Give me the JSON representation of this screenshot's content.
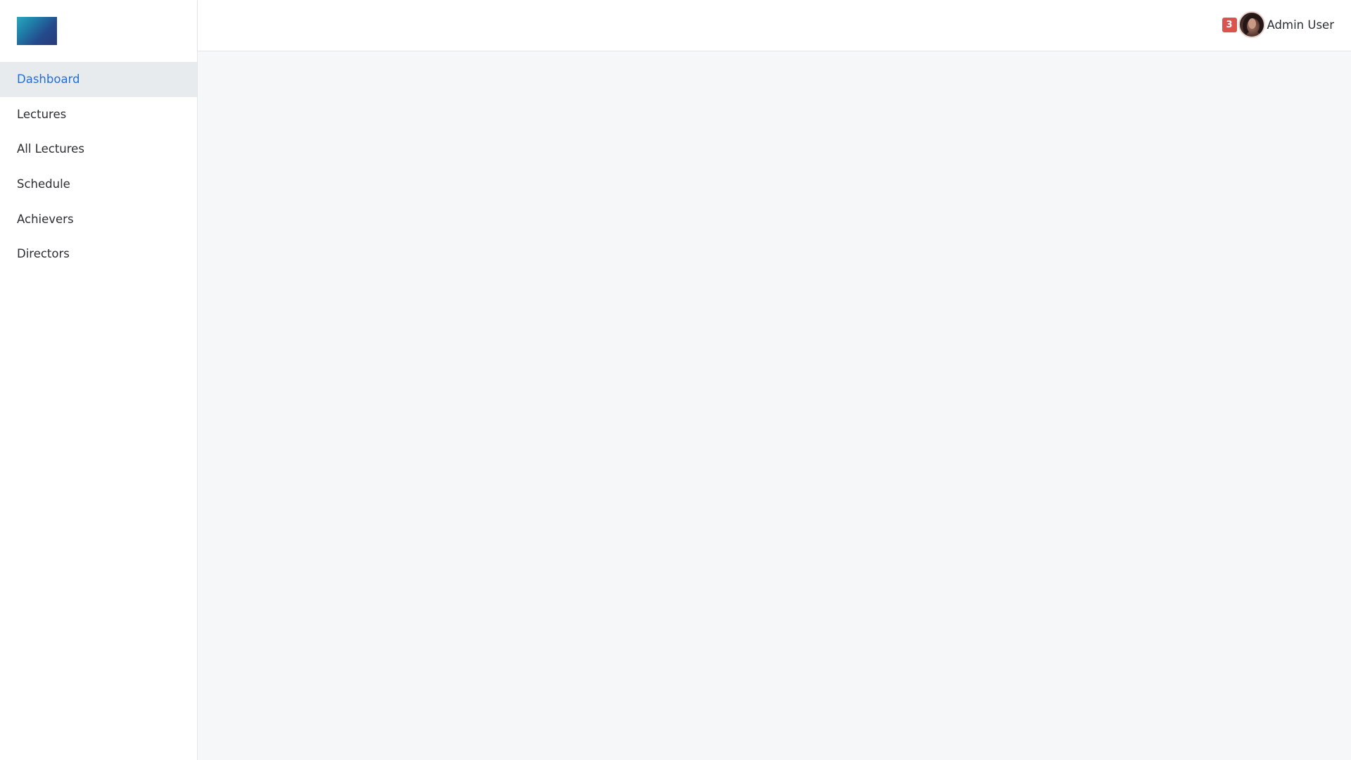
{
  "sidebar": {
    "logo": "brand-logo",
    "items": [
      {
        "label": "Dashboard",
        "active": true
      },
      {
        "label": "Lectures",
        "active": false
      },
      {
        "label": "All Lectures",
        "active": false
      },
      {
        "label": "Schedule",
        "active": false
      },
      {
        "label": "Achievers",
        "active": false
      },
      {
        "label": "Directors",
        "active": false
      }
    ]
  },
  "topbar": {
    "notification_count": "3",
    "user_name": "Admin User"
  },
  "colors": {
    "accent": "#1f6fd9",
    "badge": "#d9534f",
    "active_bg": "#e8ebee",
    "main_bg": "#f6f7f9"
  }
}
